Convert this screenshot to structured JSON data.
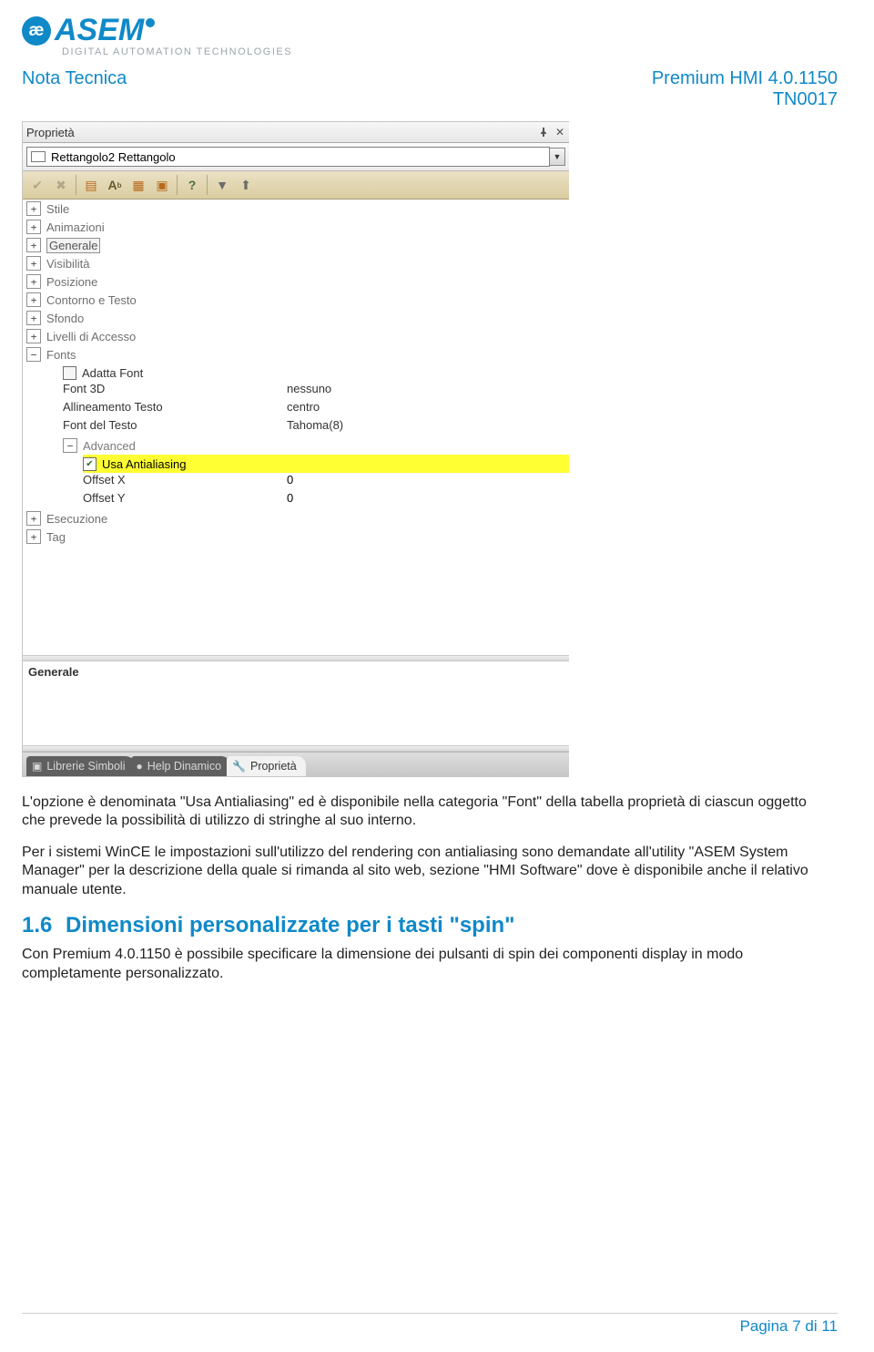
{
  "header": {
    "logo_letters": "æ",
    "logo_word": "ASEM",
    "logo_tagline": "DIGITAL AUTOMATION TECHNOLOGIES",
    "left": "Nota Tecnica",
    "right1": "Premium HMI 4.0.1150",
    "right2": "TN0017"
  },
  "panel": {
    "title": "Proprietà",
    "combo_value": "Rettangolo2 Rettangolo",
    "desc_label": "Generale",
    "categories": {
      "c0": "Stile",
      "c1": "Animazioni",
      "c2": "Generale",
      "c3": "Visibilità",
      "c4": "Posizione",
      "c5": "Contorno e Testo",
      "c6": "Sfondo",
      "c7": "Livelli di Accesso",
      "c8": "Fonts",
      "c9": "Esecuzione",
      "c10": "Tag"
    },
    "fonts": {
      "adatta": "Adatta Font",
      "font3d_k": "Font 3D",
      "font3d_v": "nessuno",
      "align_k": "Allineamento Testo",
      "align_v": "centro",
      "fontdel_k": "Font del Testo",
      "fontdel_v": "Tahoma(8)",
      "advanced": "Advanced",
      "antialias": "Usa Antialiasing",
      "offx_k": "Offset X",
      "offx_v": "0",
      "offy_k": "Offset Y",
      "offy_v": "0"
    },
    "tabs": {
      "t1": "Librerie Simboli",
      "t2": "Help Dinamico",
      "t3": "Proprietà"
    }
  },
  "body": {
    "p1": "L'opzione è denominata \"Usa Antialiasing\" ed è disponibile nella categoria \"Font\" della tabella proprietà di ciascun oggetto che prevede la possibilità di utilizzo di stringhe al suo interno.",
    "p2": "Per i sistemi WinCE le impostazioni sull'utilizzo del rendering con antialiasing sono demandate all'utility \"ASEM System Manager\" per la descrizione della quale si rimanda al sito web, sezione \"HMI Software\" dove è disponibile anche il relativo manuale utente.",
    "h2_num": "1.6",
    "h2_text": "Dimensioni personalizzate per i tasti \"spin\"",
    "p3": "Con Premium 4.0.1150 è possibile specificare la dimensione dei pulsanti di spin dei componenti display in modo completamente personalizzato."
  },
  "footer": "Pagina 7 di 11"
}
